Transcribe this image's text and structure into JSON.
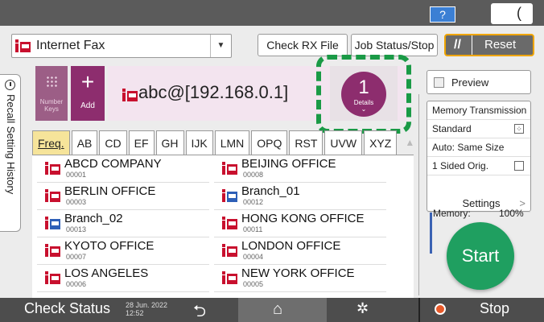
{
  "topbar": {
    "help_label": "?",
    "moon_label": "("
  },
  "function_select": {
    "value": "Internet Fax"
  },
  "buttons": {
    "check_rx_file": "Check RX File",
    "job_status_stop": "Job Status/Stop",
    "reset": "Reset"
  },
  "recall_tab": {
    "label": "Recall Setting History"
  },
  "destination": {
    "number_keys_label": "Number Keys",
    "add_label": "Add",
    "address": "abc@[192.168.0.1]",
    "count": "1",
    "details_label": "Details"
  },
  "tabs": [
    "Freq.",
    "AB",
    "CD",
    "EF",
    "GH",
    "IJK",
    "LMN",
    "OPQ",
    "RST",
    "UVW",
    "XYZ"
  ],
  "entries": [
    {
      "name": "ABCD COMPANY",
      "number": "00001",
      "icon": "fax-icon"
    },
    {
      "name": "BEIJING OFFICE",
      "number": "00008",
      "icon": "fax-icon"
    },
    {
      "name": "BERLIN OFFICE",
      "number": "00003",
      "icon": "fax-icon"
    },
    {
      "name": "Branch_01",
      "number": "00012",
      "icon": "group-icon"
    },
    {
      "name": "Branch_02",
      "number": "00013",
      "icon": "group-icon"
    },
    {
      "name": "HONG KONG OFFICE",
      "number": "00011",
      "icon": "fax-icon"
    },
    {
      "name": "KYOTO OFFICE",
      "number": "00007",
      "icon": "fax-icon"
    },
    {
      "name": "LONDON OFFICE",
      "number": "00004",
      "icon": "fax-icon"
    },
    {
      "name": "LOS ANGELES",
      "number": "00006",
      "icon": "fax-icon"
    },
    {
      "name": "NEW YORK OFFICE",
      "number": "00005",
      "icon": "fax-icon"
    }
  ],
  "right_panel": {
    "preview": "Preview",
    "memory_transmission": "Memory Transmission",
    "standard": "Standard",
    "auto_size": "Auto: Same Size",
    "sided": "1 Sided Orig.",
    "settings": "Settings",
    "memory_label": "Memory:",
    "memory_value": "100%",
    "start": "Start"
  },
  "bottombar": {
    "check_status": "Check Status",
    "date": "28 Jun. 2022",
    "time": "12:52",
    "stop": "Stop"
  },
  "colors": {
    "accent": "#8d2d6e",
    "start": "#1f9f60",
    "highlight": "#1a9a46",
    "reset_border": "#f0a500"
  }
}
